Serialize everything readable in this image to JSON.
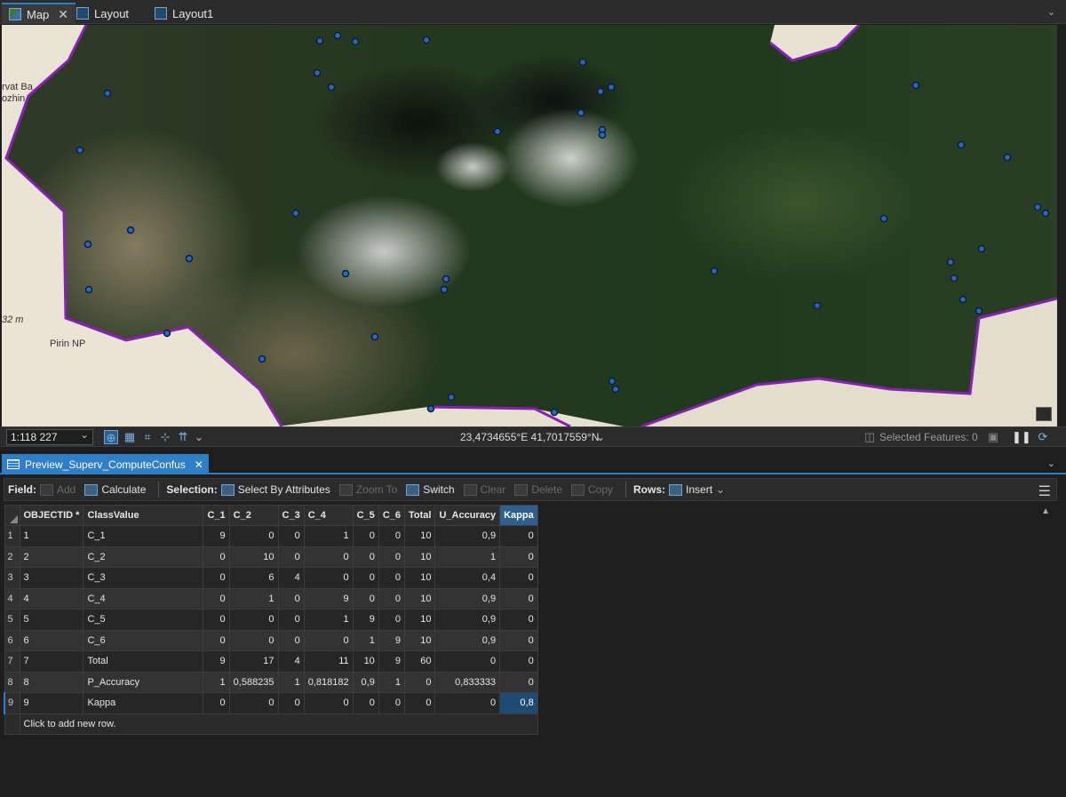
{
  "top_tabs": [
    {
      "label": "Map",
      "active": true,
      "close": "✕"
    },
    {
      "label": "Layout",
      "active": false
    },
    {
      "label": "Layout1",
      "active": false
    }
  ],
  "map": {
    "labels": {
      "place1": "Pirin NP",
      "place2": "rvat Ba",
      "place3": "ozhin",
      "elev": "32 m"
    },
    "boundary_color": "#8a1fb8",
    "point_color": "#2b67c7"
  },
  "map_status": {
    "scale": "1:118 227",
    "coordinates": "23,4734655°E 41,7017559°N",
    "selected_features": "Selected Features: 0"
  },
  "pane_tab": {
    "label": "Preview_Superv_ComputeConfus"
  },
  "toolbar": {
    "field_label": "Field:",
    "add": "Add",
    "calculate": "Calculate",
    "selection_label": "Selection:",
    "select_by_attributes": "Select By Attributes",
    "zoom_to": "Zoom To",
    "switch": "Switch",
    "clear": "Clear",
    "delete": "Delete",
    "copy": "Copy",
    "rows_label": "Rows:",
    "insert": "Insert"
  },
  "table": {
    "headers": [
      "OBJECTID *",
      "ClassValue",
      "C_1",
      "C_2",
      "C_3",
      "C_4",
      "C_5",
      "C_6",
      "Total",
      "U_Accuracy",
      "Kappa"
    ],
    "rows": [
      [
        "1",
        "1",
        "C_1",
        "9",
        "0",
        "0",
        "1",
        "0",
        "0",
        "10",
        "0,9",
        "0"
      ],
      [
        "2",
        "2",
        "C_2",
        "0",
        "10",
        "0",
        "0",
        "0",
        "0",
        "10",
        "1",
        "0"
      ],
      [
        "3",
        "3",
        "C_3",
        "0",
        "6",
        "4",
        "0",
        "0",
        "0",
        "10",
        "0,4",
        "0"
      ],
      [
        "4",
        "4",
        "C_4",
        "0",
        "1",
        "0",
        "9",
        "0",
        "0",
        "10",
        "0,9",
        "0"
      ],
      [
        "5",
        "5",
        "C_5",
        "0",
        "0",
        "0",
        "1",
        "9",
        "0",
        "10",
        "0,9",
        "0"
      ],
      [
        "6",
        "6",
        "C_6",
        "0",
        "0",
        "0",
        "0",
        "1",
        "9",
        "10",
        "0,9",
        "0"
      ],
      [
        "7",
        "7",
        "Total",
        "9",
        "17",
        "4",
        "11",
        "10",
        "9",
        "60",
        "0",
        "0"
      ],
      [
        "8",
        "8",
        "P_Accuracy",
        "1",
        "0,588235",
        "1",
        "0,818182",
        "0,9",
        "1",
        "0",
        "0,833333",
        "0"
      ],
      [
        "9",
        "9",
        "Kappa",
        "0",
        "0",
        "0",
        "0",
        "0",
        "0",
        "0",
        "0",
        "0,8"
      ]
    ],
    "add_row": "Click to add new row."
  }
}
